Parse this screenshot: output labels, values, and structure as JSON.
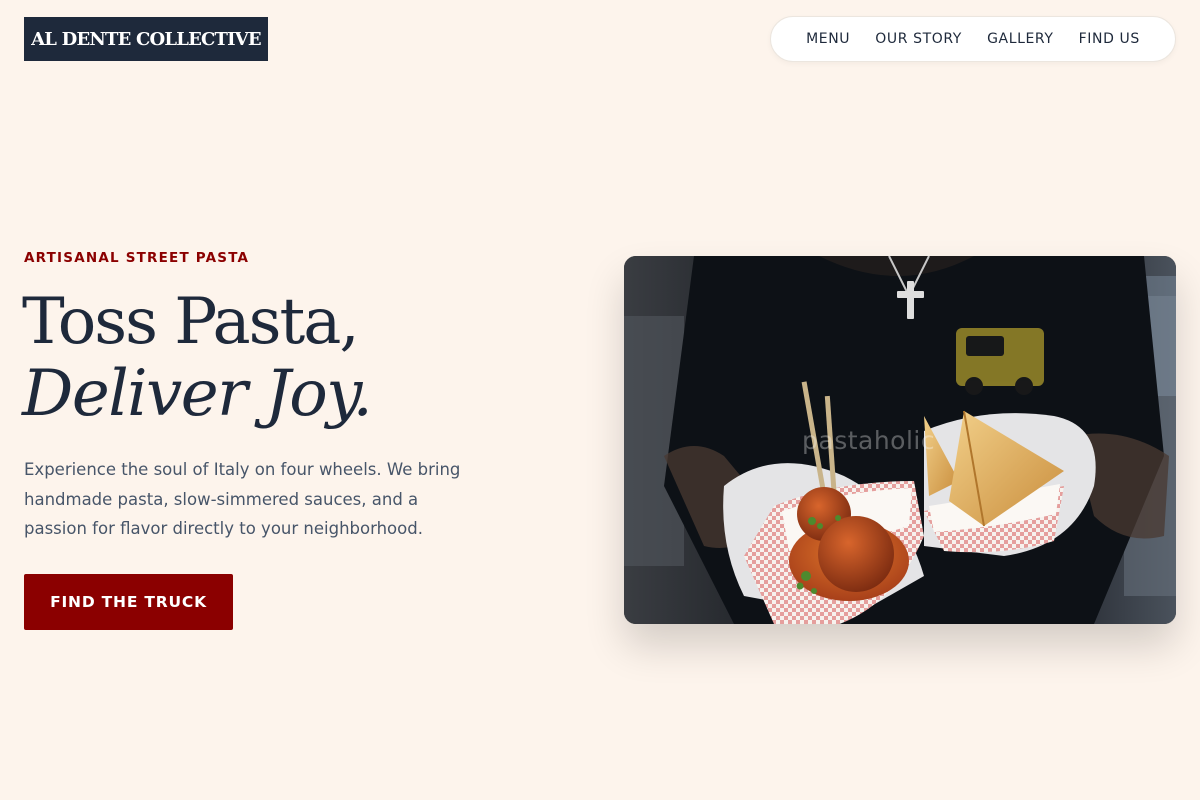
{
  "header": {
    "logo_text": "AL DENTE COLLECTIVE",
    "nav": [
      {
        "label": "MENU"
      },
      {
        "label": "OUR STORY"
      },
      {
        "label": "GALLERY"
      },
      {
        "label": "FIND US"
      }
    ]
  },
  "hero": {
    "eyebrow": "ARTISANAL STREET PASTA",
    "headline_line1": "Toss Pasta,",
    "headline_line2": "Deliver Joy.",
    "description": "Experience the soul of Italy on four wheels. We bring handmade pasta, slow-simmered sauces, and a passion for flavor directly to your neighborhood.",
    "cta_label": "FIND THE TRUCK",
    "image": {
      "watermark": "pastaholic",
      "subject": "gloved hands holding paper boats of meatballs in tomato sauce and fried pastry triangles"
    }
  },
  "colors": {
    "background": "#fdf4ec",
    "navy": "#1e293b",
    "accent_red": "#8b0000",
    "body_text": "#475569"
  }
}
